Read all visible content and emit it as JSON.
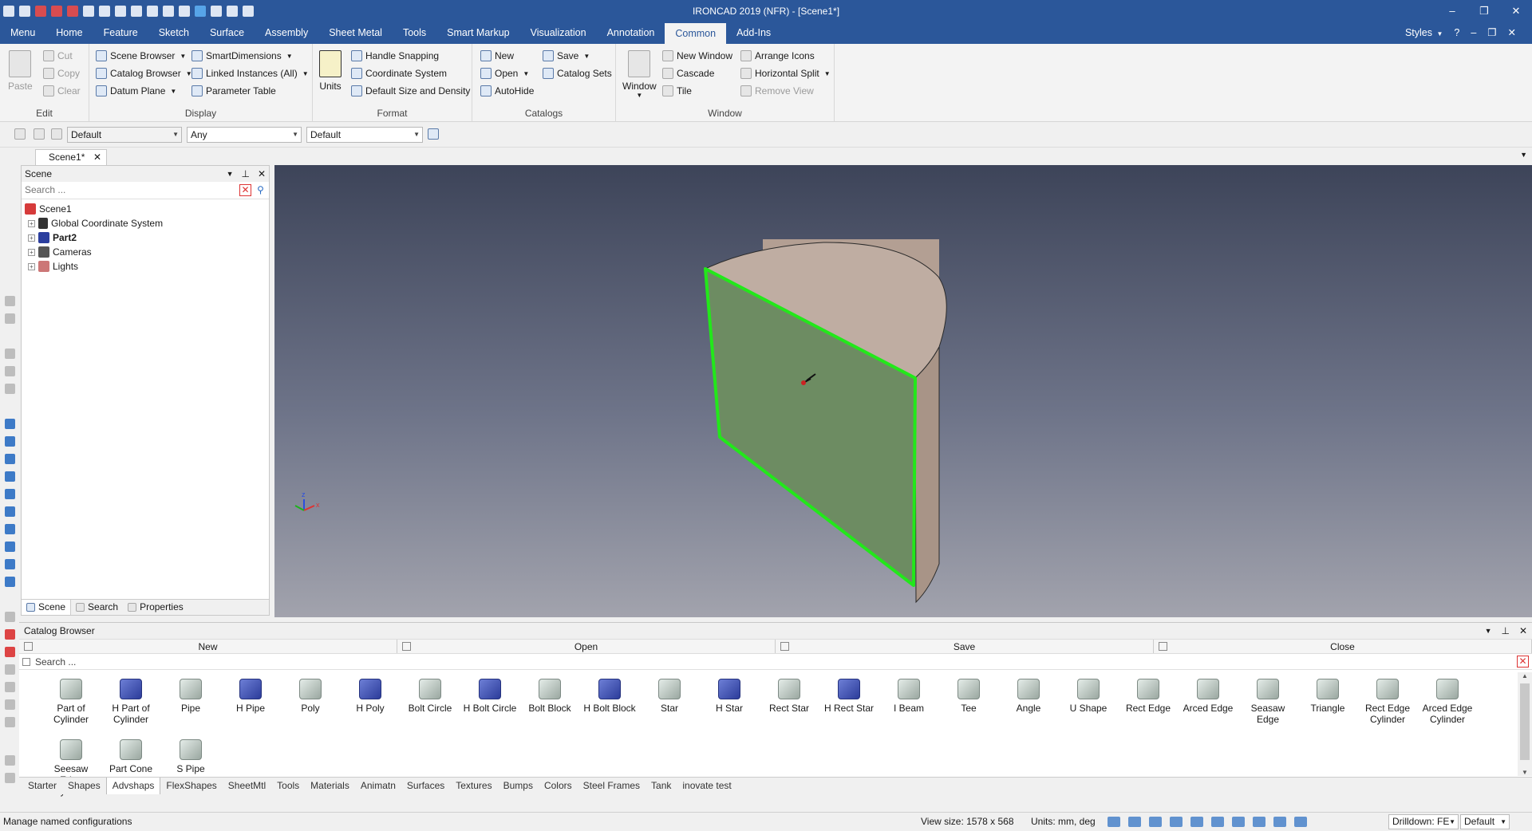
{
  "app": {
    "title": "IRONCAD 2019 (NFR) - [Scene1*]",
    "window_buttons": [
      "–",
      "❐",
      "✕"
    ]
  },
  "menu": {
    "tabs": [
      "Menu",
      "Home",
      "Feature",
      "Sketch",
      "Surface",
      "Assembly",
      "Sheet Metal",
      "Tools",
      "Smart Markup",
      "Visualization",
      "Annotation",
      "Common",
      "Add-Ins"
    ],
    "active_tab": "Common",
    "styles_label": "Styles",
    "help_icon": "?"
  },
  "ribbon": {
    "edit": {
      "label": "Edit",
      "paste": "Paste",
      "cut": "Cut",
      "copy": "Copy",
      "clear": "Clear"
    },
    "display": {
      "label": "Display",
      "scene_browser": "Scene Browser",
      "catalog_browser": "Catalog Browser",
      "datum_plane": "Datum Plane",
      "smart_dimensions": "SmartDimensions",
      "linked_instances": "Linked Instances (All)",
      "parameter_table": "Parameter Table"
    },
    "format": {
      "label": "Format",
      "units": "Units",
      "handle_snapping": "Handle Snapping",
      "coordinate_system": "Coordinate System",
      "default_size": "Default Size and Density"
    },
    "catalogs": {
      "label": "Catalogs",
      "new": "New",
      "open": "Open",
      "autohide": "AutoHide",
      "save": "Save",
      "catalog_sets": "Catalog Sets"
    },
    "window": {
      "label": "Window",
      "window_btn": "Window",
      "new_window": "New Window",
      "cascade": "Cascade",
      "tile": "Tile",
      "arrange_icons": "Arrange Icons",
      "horizontal_split": "Horizontal Split",
      "remove_view": "Remove View"
    }
  },
  "config_bar": {
    "config_select": "Default",
    "filter_select": "Any",
    "style_select": "Default"
  },
  "doc_tab": {
    "label": "Scene1*",
    "close": "✕"
  },
  "scene_panel": {
    "title": "Scene",
    "search_placeholder": "Search ...",
    "tree": [
      {
        "label": "Scene1",
        "bold": false,
        "root": true
      },
      {
        "label": "Global Coordinate System",
        "bold": false
      },
      {
        "label": "Part2",
        "bold": true
      },
      {
        "label": "Cameras",
        "bold": false
      },
      {
        "label": "Lights",
        "bold": false
      }
    ],
    "footer_tabs": [
      "Scene",
      "Search",
      "Properties"
    ]
  },
  "viewport": {
    "axis_labels": {
      "z": "z",
      "x": "x"
    },
    "colors": {
      "selected_face": "#6d8c62",
      "highlight_edge": "#22e81a",
      "body": "#b9a79a"
    }
  },
  "catalog": {
    "title": "Catalog Browser",
    "buttons": [
      "New",
      "Open",
      "Save",
      "Close"
    ],
    "search_placeholder": "Search ...",
    "items": [
      {
        "label": "Part of Cylinder",
        "style": "gray"
      },
      {
        "label": "H Part of Cylinder",
        "style": "blue"
      },
      {
        "label": "Pipe",
        "style": "gray"
      },
      {
        "label": "H Pipe",
        "style": "blue"
      },
      {
        "label": "Poly",
        "style": "gray"
      },
      {
        "label": "H Poly",
        "style": "blue"
      },
      {
        "label": "Bolt Circle",
        "style": "gray"
      },
      {
        "label": "H Bolt Circle",
        "style": "blue"
      },
      {
        "label": "Bolt Block",
        "style": "gray"
      },
      {
        "label": "H Bolt Block",
        "style": "blue"
      },
      {
        "label": "Star",
        "style": "gray"
      },
      {
        "label": "H Star",
        "style": "blue"
      },
      {
        "label": "Rect Star",
        "style": "gray"
      },
      {
        "label": "H Rect Star",
        "style": "blue"
      },
      {
        "label": "I Beam",
        "style": "gray"
      },
      {
        "label": "Tee",
        "style": "gray"
      },
      {
        "label": "Angle",
        "style": "gray"
      },
      {
        "label": "U Shape",
        "style": "gray"
      },
      {
        "label": "Rect Edge",
        "style": "gray"
      },
      {
        "label": "Arced Edge",
        "style": "gray"
      },
      {
        "label": "Seasaw Edge",
        "style": "gray"
      },
      {
        "label": "Triangle",
        "style": "gray"
      },
      {
        "label": "Rect Edge Cylinder",
        "style": "gray"
      },
      {
        "label": "Arced Edge Cylinder",
        "style": "gray"
      },
      {
        "label": "Seesaw Edge Cylinder",
        "style": "gray"
      },
      {
        "label": "Part Cone",
        "style": "gray"
      },
      {
        "label": "S Pipe",
        "style": "gray"
      }
    ],
    "tabs": [
      "Starter",
      "Shapes",
      "Advshaps",
      "FlexShapes",
      "SheetMtl",
      "Tools",
      "Materials",
      "Animatn",
      "Surfaces",
      "Textures",
      "Bumps",
      "Colors",
      "Steel Frames",
      "Tank",
      "inovate test"
    ],
    "active_tab": "Advshaps"
  },
  "status": {
    "message": "Manage named configurations",
    "view_size": "View size: 1578 x  568",
    "units": "Units: mm, deg",
    "drilldown": "Drilldown: FE",
    "style": "Default"
  }
}
